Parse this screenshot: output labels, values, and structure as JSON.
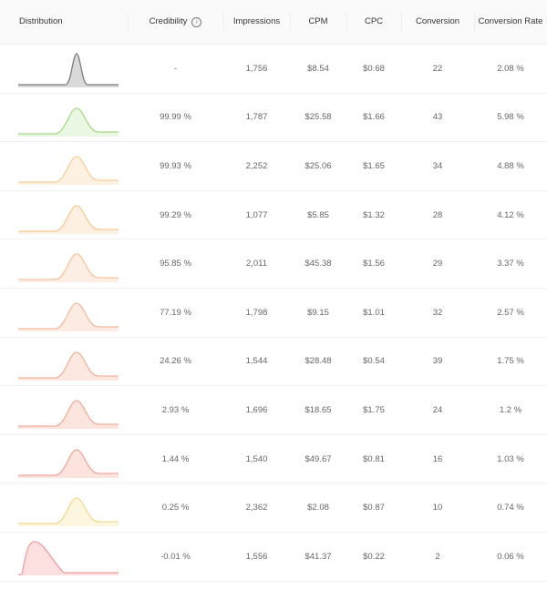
{
  "header": {
    "distribution": "Distribution",
    "credibility": "Credibility",
    "credibility_info_icon": "info-icon",
    "impressions": "Impressions",
    "cpm": "CPM",
    "cpc": "CPC",
    "conversion": "Conversion",
    "conversion_rate": "Conversion Rate"
  },
  "rows": [
    {
      "color": "#7a7a7a",
      "fill": "#d9d9d9",
      "shape": "narrow",
      "credibility": "-",
      "impressions": "1,756",
      "cpm": "$8.54",
      "cpc": "$0.68",
      "conversion": "22",
      "conversion_rate": "2.08 %"
    },
    {
      "color": "#a6d98a",
      "fill": "#eaf7e2",
      "shape": "normal",
      "credibility": "99.99 %",
      "impressions": "1,787",
      "cpm": "$25.58",
      "cpc": "$1.66",
      "conversion": "43",
      "conversion_rate": "5.98 %"
    },
    {
      "color": "#f5cf9a",
      "fill": "#fdf1e2",
      "shape": "normal",
      "credibility": "99.93 %",
      "impressions": "2,252",
      "cpm": "$25.06",
      "cpc": "$1.65",
      "conversion": "34",
      "conversion_rate": "4.88 %"
    },
    {
      "color": "#f5c998",
      "fill": "#fdf0e2",
      "shape": "normal",
      "credibility": "99.29 %",
      "impressions": "1,077",
      "cpm": "$5.85",
      "cpc": "$1.32",
      "conversion": "28",
      "conversion_rate": "4.12 %"
    },
    {
      "color": "#f5c4a0",
      "fill": "#fdeee4",
      "shape": "normal",
      "credibility": "95.85 %",
      "impressions": "2,011",
      "cpm": "$45.38",
      "cpc": "$1.56",
      "conversion": "29",
      "conversion_rate": "3.37 %"
    },
    {
      "color": "#f2bb9c",
      "fill": "#fcebe2",
      "shape": "normal",
      "credibility": "77.19 %",
      "impressions": "1,798",
      "cpm": "$9.15",
      "cpc": "$1.01",
      "conversion": "32",
      "conversion_rate": "2.57 %"
    },
    {
      "color": "#f0b39c",
      "fill": "#fce8e0",
      "shape": "normal",
      "credibility": "24.26 %",
      "impressions": "1,544",
      "cpm": "$28.48",
      "cpc": "$0.54",
      "conversion": "39",
      "conversion_rate": "1.75 %"
    },
    {
      "color": "#efad9c",
      "fill": "#fce5df",
      "shape": "normal",
      "credibility": "2.93 %",
      "impressions": "1,696",
      "cpm": "$18.65",
      "cpc": "$1.75",
      "conversion": "24",
      "conversion_rate": "1.2 %"
    },
    {
      "color": "#eea69a",
      "fill": "#fce3de",
      "shape": "normal",
      "credibility": "1.44 %",
      "impressions": "1,540",
      "cpm": "$49.67",
      "cpc": "$0.81",
      "conversion": "16",
      "conversion_rate": "1.03 %"
    },
    {
      "color": "#f2d88f",
      "fill": "#fdf6df",
      "shape": "normal",
      "credibility": "0.25 %",
      "impressions": "2,362",
      "cpm": "$2.08",
      "cpc": "$0.87",
      "conversion": "10",
      "conversion_rate": "0.74 %"
    },
    {
      "color": "#ec9f9f",
      "fill": "#fce0e0",
      "shape": "skew",
      "credibility": "-0.01 %",
      "impressions": "1,556",
      "cpm": "$41.37",
      "cpc": "$0.22",
      "conversion": "2",
      "conversion_rate": "0.06 %"
    }
  ]
}
